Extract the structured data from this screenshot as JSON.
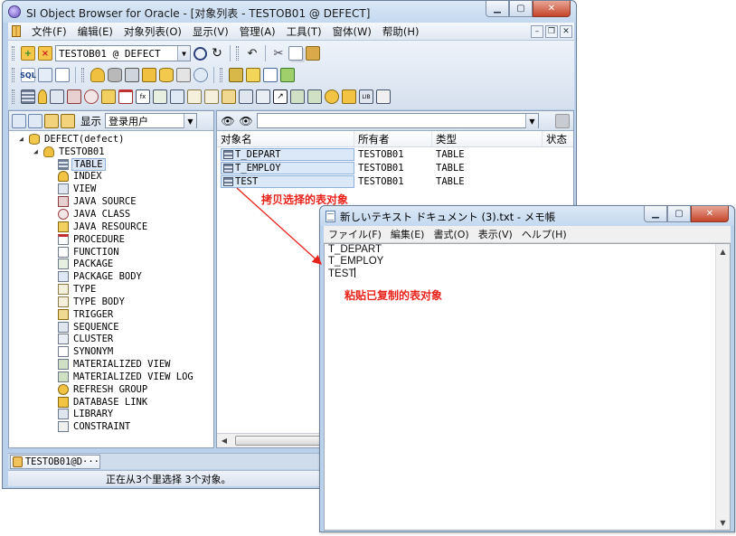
{
  "main_window": {
    "title": "SI Object Browser for Oracle - [对象列表 - TESTOB01 @ DEFECT]",
    "menu": [
      "文件(F)",
      "编辑(E)",
      "对象列表(O)",
      "显示(V)",
      "管理(A)",
      "工具(T)",
      "窗体(W)",
      "帮助(H)"
    ],
    "schema_combo": "TESTOB01 @ DEFECT",
    "filter_label": "显示",
    "filter_value": "登录用户",
    "tree": {
      "root": "DEFECT(defect)",
      "user": "TESTOB01",
      "types": [
        "TABLE",
        "INDEX",
        "VIEW",
        "JAVA SOURCE",
        "JAVA CLASS",
        "JAVA RESOURCE",
        "PROCEDURE",
        "FUNCTION",
        "PACKAGE",
        "PACKAGE BODY",
        "TYPE",
        "TYPE BODY",
        "TRIGGER",
        "SEQUENCE",
        "CLUSTER",
        "SYNONYM",
        "MATERIALIZED VIEW",
        "MATERIALIZED VIEW LOG",
        "REFRESH GROUP",
        "DATABASE LINK",
        "LIBRARY",
        "CONSTRAINT"
      ],
      "selected": "TABLE"
    },
    "list": {
      "columns": [
        "对象名",
        "所有者",
        "类型",
        "状态"
      ],
      "rows": [
        {
          "name": "T_DEPART",
          "owner": "TESTOB01",
          "type": "TABLE"
        },
        {
          "name": "T_EMPLOY",
          "owner": "TESTOB01",
          "type": "TABLE"
        },
        {
          "name": "TEST",
          "owner": "TESTOB01",
          "type": "TABLE"
        }
      ],
      "scroll_thumb_label": "III"
    },
    "doc_tab": "TESTOB01@D···",
    "status": "正在从3个里选择 3个对象。"
  },
  "notepad": {
    "title": "新しいテキスト ドキュメント (3).txt - メモ帳",
    "menu": [
      "ファイル(F)",
      "編集(E)",
      "書式(O)",
      "表示(V)",
      "ヘルプ(H)"
    ],
    "lines": [
      "T_DEPART",
      "T_EMPLOY",
      "TEST"
    ]
  },
  "annotations": {
    "copy": "拷贝选择的表对象",
    "paste": "粘贴已复制的表对象",
    "color": "#e8231b"
  }
}
